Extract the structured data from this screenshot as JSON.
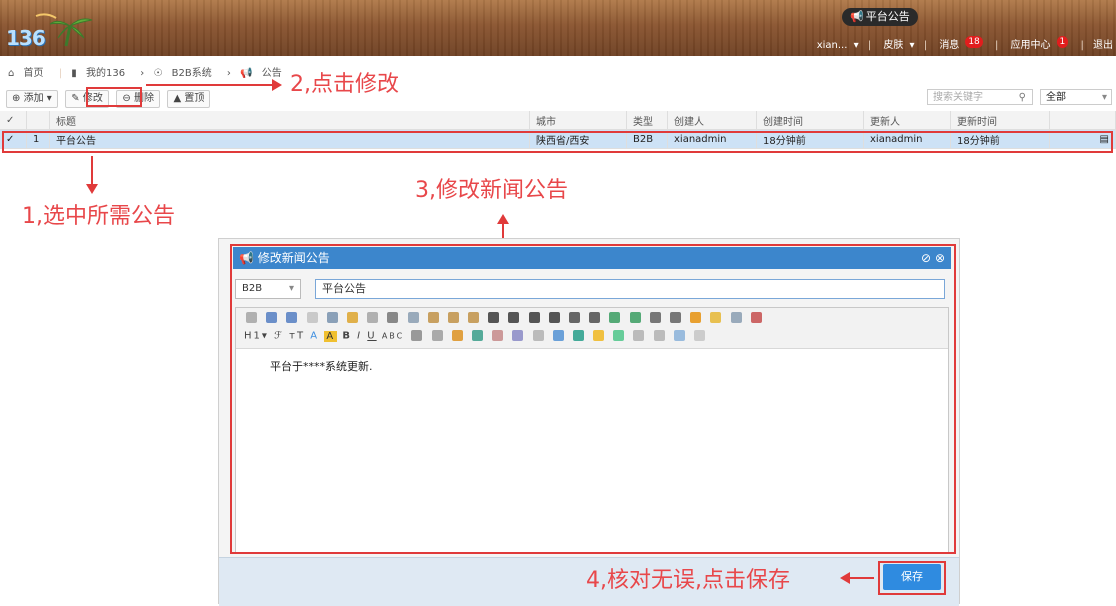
{
  "header": {
    "logo_text": "136",
    "notice_label": "平台公告",
    "nav": {
      "user": "xian...",
      "skin": "皮肤",
      "messages": "消息",
      "messages_badge": "18",
      "app_center": "应用中心",
      "app_center_badge": "1",
      "logout": "退出"
    }
  },
  "breadcrumb": {
    "home": "首页",
    "my": "我的136",
    "system": "B2B系统",
    "current": "公告"
  },
  "toolbar": {
    "add": "添加",
    "edit": "修改",
    "delete": "删除",
    "pin": "置顶"
  },
  "search": {
    "placeholder": "搜索关键字",
    "scope": "全部"
  },
  "table": {
    "headers": [
      "标题",
      "城市",
      "类型",
      "创建人",
      "创建时间",
      "更新人",
      "更新时间"
    ],
    "rows": [
      {
        "num": "1",
        "title": "平台公告",
        "city": "陕西省/西安",
        "type": "B2B",
        "creator": "xianadmin",
        "created": "18分钟前",
        "updater": "xianadmin",
        "updated": "18分钟前"
      }
    ]
  },
  "annotations": {
    "step1": "1,选中所需公告",
    "step2": "2,点击修改",
    "step3": "3,修改新闻公告",
    "step4": "4,核对无误,点击保存"
  },
  "dialog": {
    "title": "修改新闻公告",
    "type_value": "B2B",
    "title_value": "平台公告",
    "toolbar_row2": [
      "H1",
      "A",
      "B",
      "I",
      "U",
      "ABC"
    ],
    "body_text": "平台于****系统更新.",
    "save": "保存"
  },
  "colors": {
    "accent_blue": "#3c86cc",
    "annotation_red": "#e03a3a",
    "selected_row": "#cde2f6"
  }
}
